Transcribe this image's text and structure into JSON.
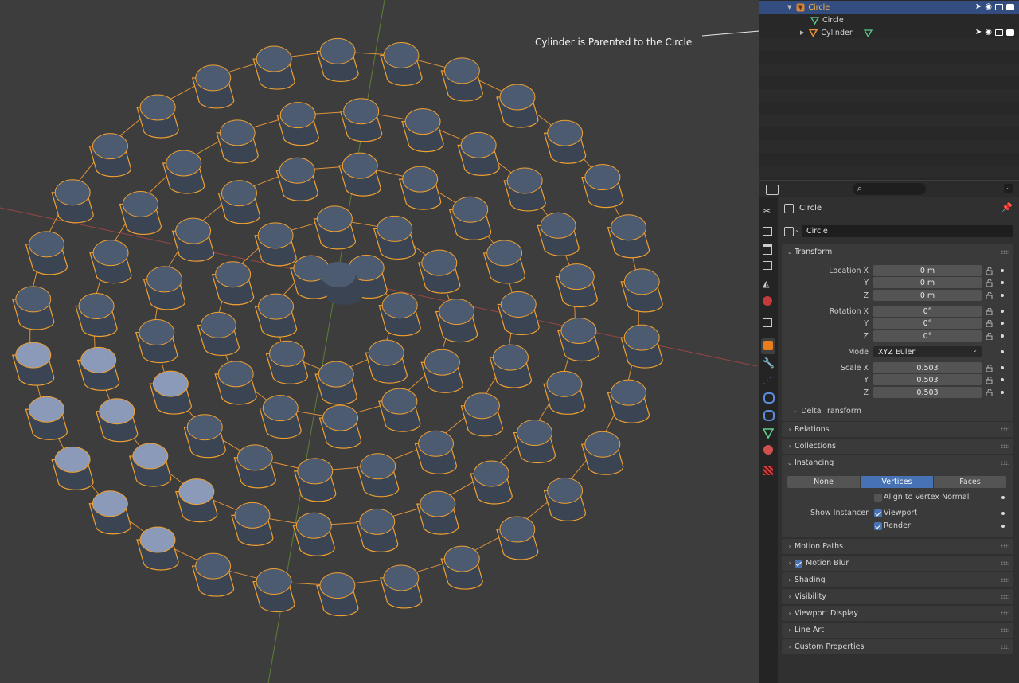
{
  "annotation": "Cylinder is Parented to the Circle",
  "outliner": {
    "rows": [
      {
        "label": "Circle",
        "kind": "object",
        "selected": true
      },
      {
        "label": "Circle",
        "kind": "mesh-data"
      },
      {
        "label": "Cylinder",
        "kind": "object"
      }
    ]
  },
  "properties": {
    "object_name": "Circle",
    "name_field": "Circle",
    "transform": {
      "title": "Transform",
      "location_label": "Location X",
      "location": [
        "0 m",
        "0 m",
        "0 m"
      ],
      "rotation_label": "Rotation X",
      "rotation": [
        "0°",
        "0°",
        "0°"
      ],
      "mode_label": "Mode",
      "mode": "XYZ Euler",
      "scale_label": "Scale X",
      "scale": [
        "0.503",
        "0.503",
        "0.503"
      ],
      "axis_y": "Y",
      "axis_z": "Z",
      "delta": "Delta Transform"
    },
    "relations": "Relations",
    "collections": "Collections",
    "instancing": {
      "title": "Instancing",
      "options": [
        "None",
        "Vertices",
        "Faces"
      ],
      "active": "Vertices",
      "align_label": "Align to Vertex Normal",
      "show_instancer_label": "Show Instancer",
      "viewport_label": "Viewport",
      "render_label": "Render"
    },
    "panels_below": [
      "Motion Paths",
      "Motion Blur",
      "Shading",
      "Visibility",
      "Viewport Display",
      "Line Art",
      "Custom Properties"
    ]
  },
  "colors": {
    "selection_outline": "#f5a030",
    "active_blue": "#4772b3",
    "x_axis": "#a04848",
    "y_axis": "#6a8a3a"
  }
}
